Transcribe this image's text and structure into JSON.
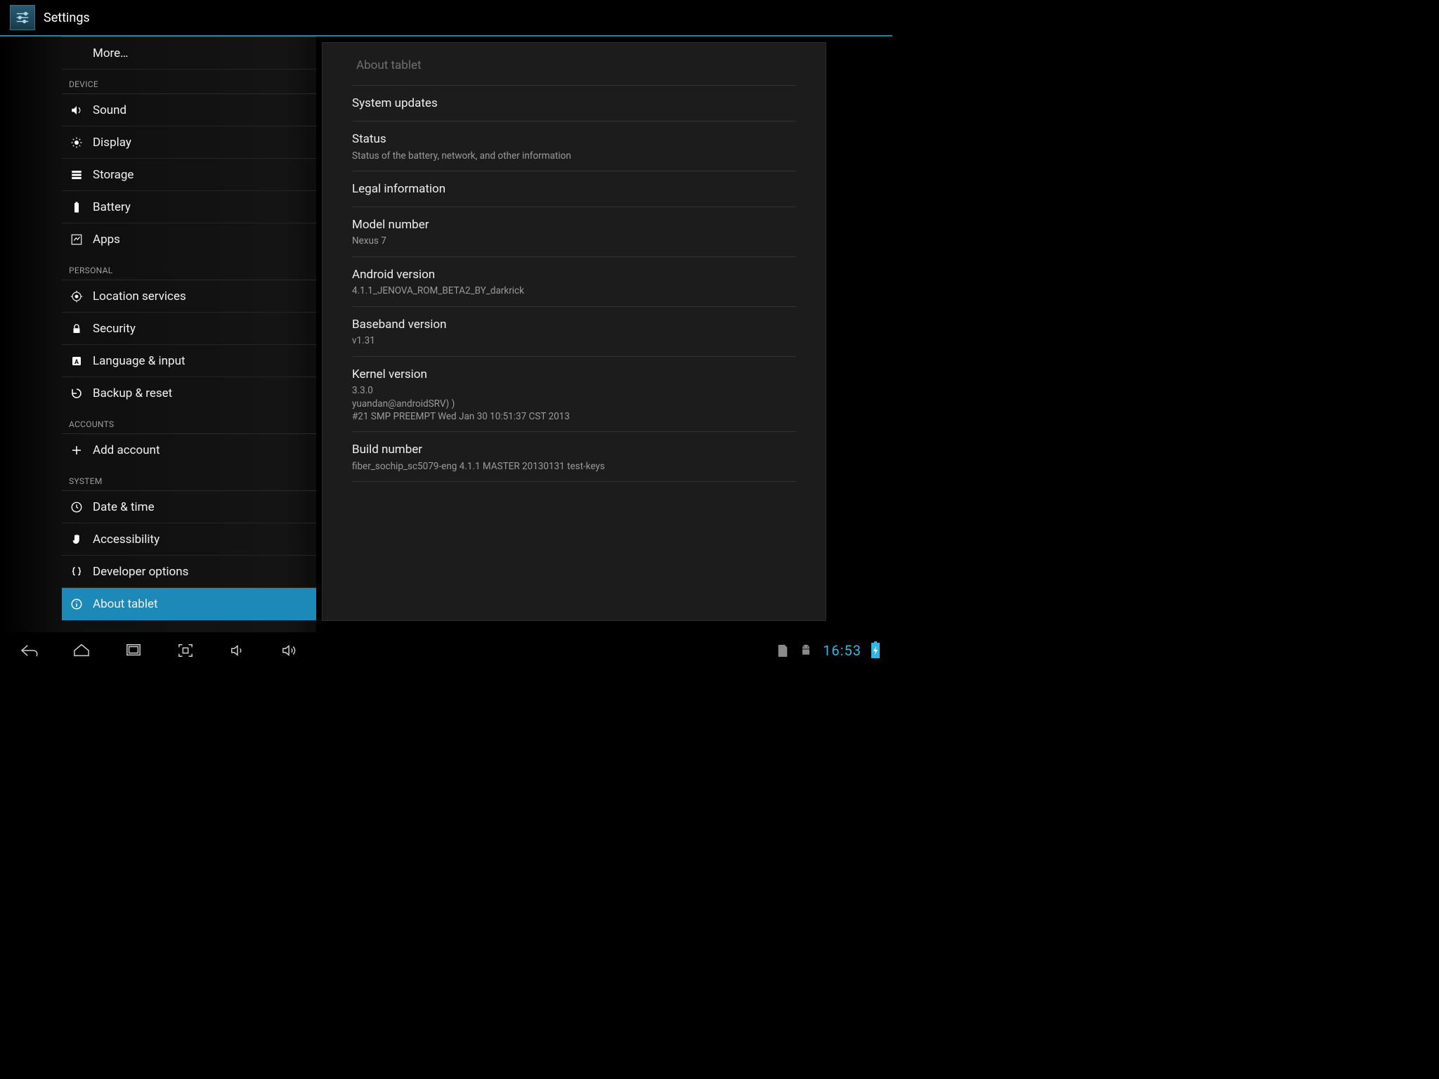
{
  "header": {
    "title": "Settings"
  },
  "sidebar": {
    "more_label": "More…",
    "sections": {
      "device": {
        "heading": "DEVICE",
        "items": [
          {
            "label": "Sound"
          },
          {
            "label": "Display"
          },
          {
            "label": "Storage"
          },
          {
            "label": "Battery"
          },
          {
            "label": "Apps"
          }
        ]
      },
      "personal": {
        "heading": "PERSONAL",
        "items": [
          {
            "label": "Location services"
          },
          {
            "label": "Security"
          },
          {
            "label": "Language & input"
          },
          {
            "label": "Backup & reset"
          }
        ]
      },
      "accounts": {
        "heading": "ACCOUNTS",
        "items": [
          {
            "label": "Add account"
          }
        ]
      },
      "system": {
        "heading": "SYSTEM",
        "items": [
          {
            "label": "Date & time"
          },
          {
            "label": "Accessibility"
          },
          {
            "label": "Developer options"
          },
          {
            "label": "About tablet"
          }
        ]
      }
    }
  },
  "panel": {
    "title": "About tablet",
    "rows": [
      {
        "title": "System updates",
        "subtitle": ""
      },
      {
        "title": "Status",
        "subtitle": "Status of the battery, network, and other information"
      },
      {
        "title": "Legal information",
        "subtitle": ""
      },
      {
        "title": "Model number",
        "subtitle": "Nexus 7"
      },
      {
        "title": "Android version",
        "subtitle": "4.1.1_JENOVA_ROM_BETA2_BY_darkrick"
      },
      {
        "title": "Baseband version",
        "subtitle": "v1.31"
      },
      {
        "title": "Kernel version",
        "subtitle": "3.3.0\nyuandan@androidSRV) )\n#21 SMP PREEMPT Wed Jan 30 10:51:37 CST 2013"
      },
      {
        "title": "Build number",
        "subtitle": "fiber_sochip_sc5079-eng 4.1.1 MASTER 20130131 test-keys"
      }
    ]
  },
  "statusbar": {
    "time": "16:53"
  }
}
